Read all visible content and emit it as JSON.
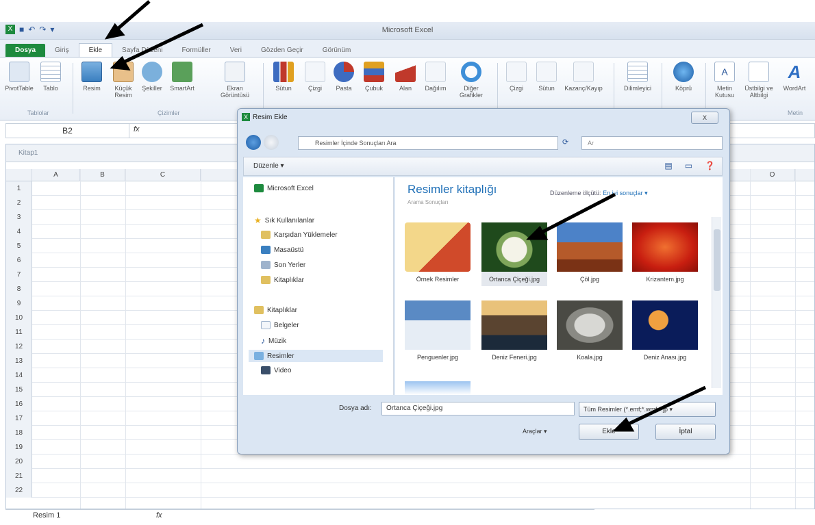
{
  "window": {
    "title": "Microsoft Excel"
  },
  "ribbon": {
    "tabs": [
      "Dosya",
      "Giriş",
      "Ekle",
      "Sayfa Düzeni",
      "Formüller",
      "Veri",
      "Gözden Geçir",
      "Görünüm"
    ],
    "groups": [
      "Tablolar",
      "Çizimler",
      "Metin"
    ],
    "buttons": [
      {
        "label": "PivotTable",
        "icon": "pivottable-icon"
      },
      {
        "label": "Tablo",
        "icon": "table-icon"
      },
      {
        "label": "Resim",
        "icon": "picture-icon"
      },
      {
        "label": "Küçük Resim",
        "icon": "clipart-icon"
      },
      {
        "label": "Şekiller",
        "icon": "shapes-icon"
      },
      {
        "label": "SmartArt",
        "icon": "smartart-icon"
      },
      {
        "label": "Ekran Görüntüsü",
        "icon": "screenshot-icon"
      },
      {
        "label": "Sütun",
        "icon": "column-chart-icon"
      },
      {
        "label": "Çizgi",
        "icon": "line-chart-icon"
      },
      {
        "label": "Pasta",
        "icon": "pie-chart-icon"
      },
      {
        "label": "Çubuk",
        "icon": "bar-chart-icon"
      },
      {
        "label": "Alan",
        "icon": "area-chart-icon"
      },
      {
        "label": "Dağılım",
        "icon": "scatter-chart-icon"
      },
      {
        "label": "Diğer Grafikler",
        "icon": "other-charts-icon"
      },
      {
        "label": "Çizgi",
        "icon": "sparkline-line-icon"
      },
      {
        "label": "Sütun",
        "icon": "sparkline-column-icon"
      },
      {
        "label": "Kazanç/Kayıp",
        "icon": "winloss-icon"
      },
      {
        "label": "Dilimleyici",
        "icon": "slicer-icon"
      },
      {
        "label": "Köprü",
        "icon": "hyperlink-icon"
      },
      {
        "label": "Metin Kutusu",
        "icon": "textbox-icon"
      },
      {
        "label": "Üstbilgi ve Altbilgi",
        "icon": "header-footer-icon"
      },
      {
        "label": "WordArt",
        "icon": "wordart-icon"
      }
    ]
  },
  "formula_bar": {
    "name_box": "B2",
    "fx": "fx"
  },
  "workbook": {
    "title": "Kitap1",
    "columns": [
      "A",
      "B",
      "C",
      "O"
    ],
    "rows": [
      "1",
      "2",
      "3",
      "4",
      "5",
      "6",
      "7",
      "8",
      "9",
      "10",
      "11",
      "12",
      "13",
      "14",
      "15",
      "16",
      "17",
      "18",
      "19",
      "20",
      "21",
      "22"
    ]
  },
  "bottom": {
    "name_box": "Resim 1",
    "fx": "fx"
  },
  "dialog": {
    "title": "Resim Ekle",
    "close": "X",
    "address": "Resimler İçinde Sonuçları Ara",
    "search_placeholder": "Ar",
    "organize": "Düzenle ▾",
    "nav": {
      "top": "Microsoft Excel",
      "favorites_header": "Sık Kullanılanlar",
      "favorites": [
        "Karşıdan Yüklemeler",
        "Masaüstü",
        "Son Yerler",
        "Kitaplıklar"
      ],
      "libraries_header": "Kitaplıklar",
      "libraries": [
        "Belgeler",
        "Müzik",
        "Resimler",
        "Video"
      ]
    },
    "library_title": "Resimler kitaplığı",
    "library_subtitle": "Arama Sonuçları",
    "arrange_label": "Düzenleme ölçütü:",
    "arrange_value": "En iyi sonuçlar ▾",
    "files": [
      {
        "name": "Örnek Resimler"
      },
      {
        "name": "Ortanca Çiçeği.jpg"
      },
      {
        "name": "Çöl.jpg"
      },
      {
        "name": "Krizantem.jpg"
      },
      {
        "name": "Penguenler.jpg"
      },
      {
        "name": "Deniz Feneri.jpg"
      },
      {
        "name": "Koala.jpg"
      },
      {
        "name": "Deniz Anası.jpg"
      }
    ],
    "filename_label": "Dosya adı:",
    "filename_value": "Ortanca Çiçeği.jpg",
    "filetype_value": "Tüm Resimler (*.emf;*.wmf;*.jp ▾",
    "tools_label": "Araçlar ▾",
    "insert_button": "Ekle",
    "cancel_button": "İptal"
  }
}
